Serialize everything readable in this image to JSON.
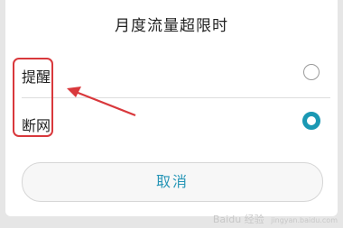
{
  "dialog": {
    "title": "月度流量超限时",
    "options": [
      {
        "label": "提醒",
        "selected": false
      },
      {
        "label": "断网",
        "selected": true
      }
    ],
    "cancel_label": "取消"
  },
  "annotation": {
    "highlight_color": "#d9383c"
  },
  "accent_color": "#1a98b3",
  "watermark": {
    "text": "Baidu 经验",
    "url": "jingyan.baidu.com"
  }
}
